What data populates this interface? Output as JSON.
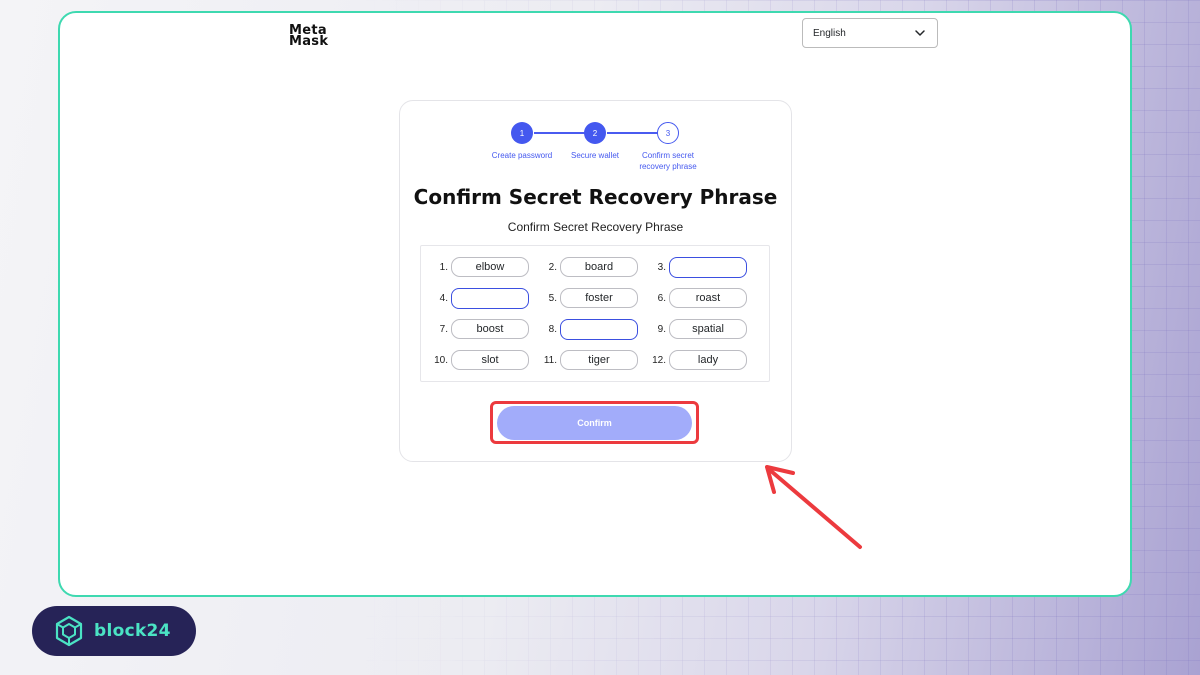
{
  "logo": {
    "line1": "Meta",
    "line2": "Mask"
  },
  "language_select": {
    "selected": "English"
  },
  "stepper": {
    "steps": [
      {
        "number": "1",
        "label": "Create password",
        "status": "complete"
      },
      {
        "number": "2",
        "label": "Secure wallet",
        "status": "complete"
      },
      {
        "number": "3",
        "label": "Confirm secret recovery phrase",
        "status": "pending"
      }
    ]
  },
  "title": "Confirm Secret Recovery Phrase",
  "subtitle": "Confirm Secret Recovery Phrase",
  "words": [
    {
      "number": "1.",
      "word": "elbow"
    },
    {
      "number": "2.",
      "word": "board"
    },
    {
      "number": "3.",
      "word": ""
    },
    {
      "number": "4.",
      "word": ""
    },
    {
      "number": "5.",
      "word": "foster"
    },
    {
      "number": "6.",
      "word": "roast"
    },
    {
      "number": "7.",
      "word": "boost"
    },
    {
      "number": "8.",
      "word": ""
    },
    {
      "number": "9.",
      "word": "spatial"
    },
    {
      "number": "10.",
      "word": "slot"
    },
    {
      "number": "11.",
      "word": "tiger"
    },
    {
      "number": "12.",
      "word": "lady"
    }
  ],
  "confirm_button": {
    "label": "Confirm",
    "state": "disabled"
  },
  "watermark": {
    "text": "block24"
  },
  "colors": {
    "accent": "#4458ef",
    "confirm_disabled": "#a2acfa",
    "highlight": "#ec3a3e",
    "frame_border": "#3ed9b0"
  }
}
